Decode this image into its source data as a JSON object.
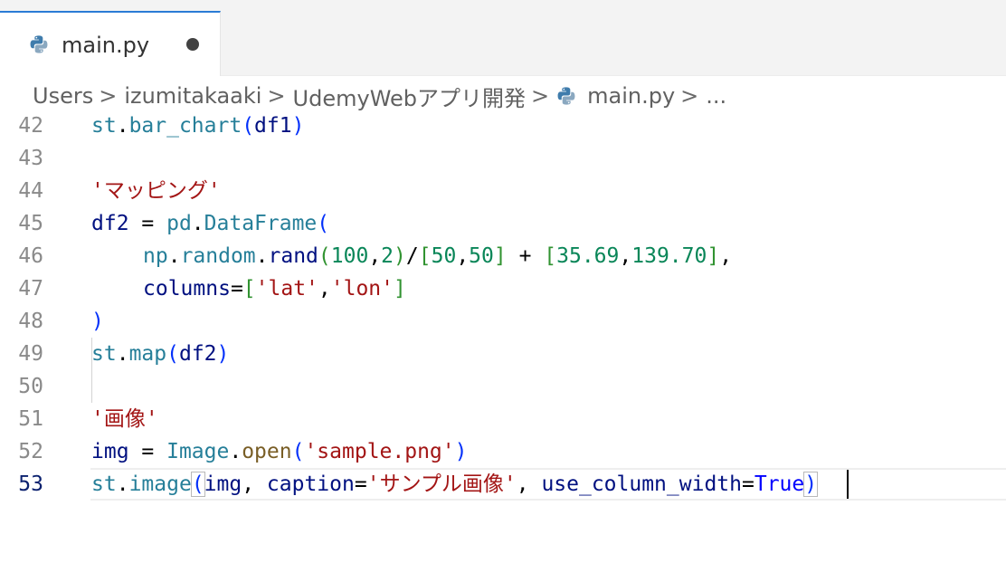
{
  "tab": {
    "filename": "main.py",
    "icon": "python-icon",
    "dirty": true,
    "accent": "#2a7bd5"
  },
  "breadcrumb": {
    "segments": [
      "Users",
      "izumitakaaki",
      "UdemyWebアプリ開発"
    ],
    "file": "main.py",
    "ellipsis": "...",
    "separator": ">"
  },
  "editor": {
    "current_line": "53",
    "lines": [
      {
        "number": "42"
      },
      {
        "number": "43"
      },
      {
        "number": "44"
      },
      {
        "number": "45"
      },
      {
        "number": "46"
      },
      {
        "number": "47"
      },
      {
        "number": "48"
      },
      {
        "number": "49"
      },
      {
        "number": "50"
      },
      {
        "number": "51"
      },
      {
        "number": "52"
      },
      {
        "number": "53"
      }
    ],
    "tokens": {
      "l42": [
        "st",
        ".",
        "bar_chart",
        "(",
        "df1",
        ")"
      ],
      "l44": [
        "'マッピング'"
      ],
      "l45": [
        "df2",
        " = ",
        "pd",
        ".",
        "DataFrame",
        "("
      ],
      "l46": [
        "np",
        ".",
        "random",
        ".",
        "rand",
        "(",
        "100",
        ",",
        "2",
        ")",
        "/",
        "[",
        "50",
        ",",
        "50",
        "]",
        " + ",
        "[",
        "35.69",
        ",",
        "139.70",
        "]",
        ","
      ],
      "l47": [
        "columns",
        "=",
        "[",
        "'lat'",
        ",",
        "'lon'",
        "]"
      ],
      "l48": [
        ")"
      ],
      "l49": [
        "st",
        ".",
        "map",
        "(",
        "df2",
        ")"
      ],
      "l51": [
        "'画像'"
      ],
      "l52": [
        "img",
        " = ",
        "Image",
        ".",
        "open",
        "(",
        "'sample.png'",
        ")"
      ],
      "l53": [
        "st",
        ".",
        "image",
        "(",
        "img",
        ", ",
        "caption",
        "=",
        "'サンプル画像'",
        ", ",
        "use_column_width",
        "=",
        "True",
        ")"
      ]
    }
  }
}
